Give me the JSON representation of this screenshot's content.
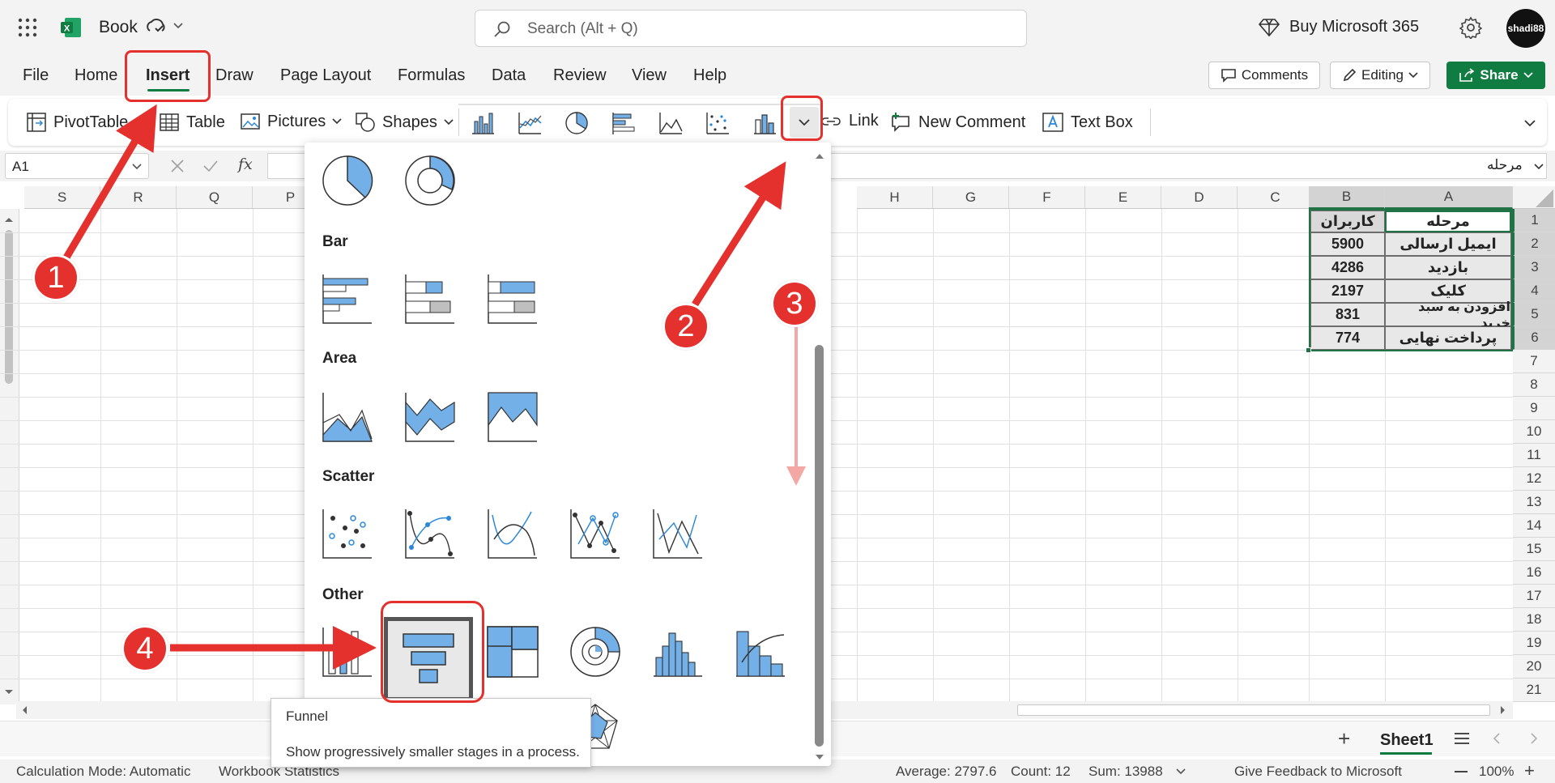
{
  "titlebar": {
    "app_name": "Book",
    "search_placeholder": "Search (Alt + Q)",
    "buy_label": "Buy Microsoft 365",
    "avatar_text": "shadi88"
  },
  "menu": {
    "tabs": [
      "File",
      "Home",
      "Insert",
      "Draw",
      "Page Layout",
      "Formulas",
      "Data",
      "Review",
      "View",
      "Help"
    ],
    "comments_label": "Comments",
    "editing_label": "Editing",
    "share_label": "Share"
  },
  "ribbon": {
    "pivottable_label": "PivotTable",
    "table_label": "Table",
    "pictures_label": "Pictures",
    "shapes_label": "Shapes",
    "link_label": "Link",
    "new_comment_label": "New Comment",
    "text_box_label": "Text Box"
  },
  "formula_bar": {
    "name_box": "A1",
    "fx": "fx",
    "content": "مرحله"
  },
  "grid": {
    "columns": [
      "S",
      "R",
      "Q",
      "P",
      "H",
      "G",
      "F",
      "E",
      "D",
      "C",
      "B",
      "A"
    ],
    "rows": [
      "1",
      "2",
      "3",
      "4",
      "5",
      "6",
      "7",
      "8",
      "9",
      "10",
      "11",
      "12",
      "13",
      "14",
      "15",
      "16",
      "17",
      "18",
      "19",
      "20",
      "21"
    ],
    "table": {
      "headers": [
        "کاربران",
        "مرحله"
      ],
      "rows": [
        [
          "5900",
          "ایمیل ارسالی"
        ],
        [
          "4286",
          "بازدید"
        ],
        [
          "2197",
          "کلیک"
        ],
        [
          "831",
          "افزودن به سبد خرید"
        ],
        [
          "774",
          "پرداخت نهایی"
        ]
      ]
    }
  },
  "dropdown": {
    "sections": [
      "Bar",
      "Area",
      "Scatter",
      "Other"
    ],
    "tooltip_title": "Funnel",
    "tooltip_desc": "Show progressively smaller stages in a process."
  },
  "sheetbar": {
    "add_label": "+",
    "sheet_name": "Sheet1"
  },
  "statusbar": {
    "calc_mode": "Calculation Mode: Automatic",
    "workbook_stats": "Workbook Statistics",
    "average": "Average: 2797.6",
    "count": "Count: 12",
    "sum": "Sum: 13988",
    "feedback": "Give Feedback to Microsoft",
    "zoom": "100%"
  },
  "annotations": {
    "badges": [
      "1",
      "2",
      "3",
      "4"
    ]
  },
  "colors": {
    "excel_green": "#107c41",
    "accent_red": "#e4312e",
    "chart_blue": "#74b0e8",
    "selection_green": "#217346"
  }
}
